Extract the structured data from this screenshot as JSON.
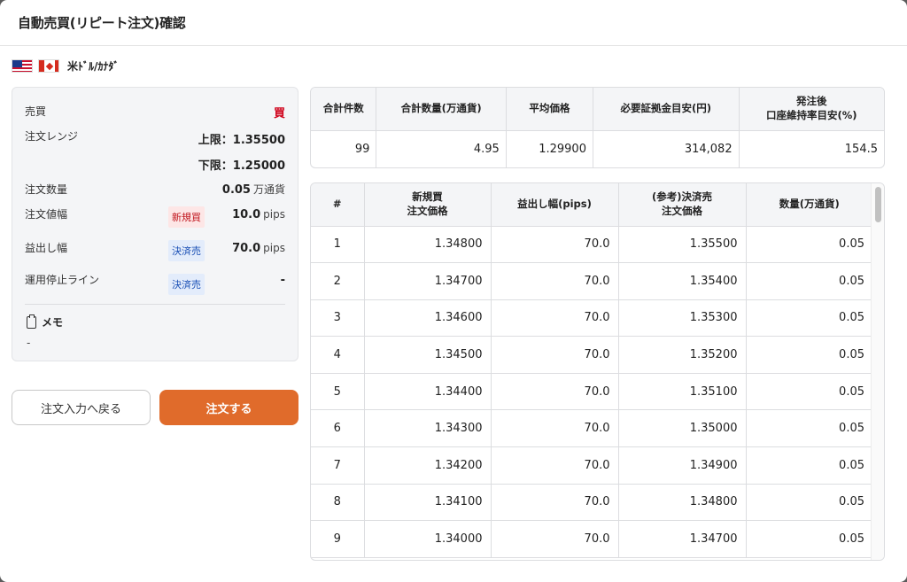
{
  "dialog": {
    "title": "自動売買(リピート注文)確認"
  },
  "pair": {
    "name": "米ﾄﾞﾙ/ｶﾅﾀﾞ",
    "flags": [
      "us-flag-icon",
      "canada-flag-icon"
    ]
  },
  "summary": {
    "side_label": "売買",
    "side_value": "買",
    "range_label": "注文レンジ",
    "upper": "上限：1.35500",
    "lower": "下限：1.25000",
    "qty_label": "注文数量",
    "qty_value": "0.05",
    "qty_unit": "万通貨",
    "width_label": "注文値幅",
    "width_badge": "新規買",
    "width_value": "10.0",
    "width_unit": "pips",
    "profit_label": "益出し幅",
    "profit_badge": "決済売",
    "profit_value": "70.0",
    "profit_unit": "pips",
    "stop_label": "運用停止ライン",
    "stop_badge": "決済売",
    "stop_value": "-",
    "memo_label": "メモ",
    "memo_value": "-"
  },
  "buttons": {
    "back": "注文入力へ戻る",
    "order": "注文する"
  },
  "totals": {
    "headers": [
      "合計件数",
      "合計数量(万通貨)",
      "平均価格",
      "必要証拠金目安(円)",
      "発注後\n口座維持率目安(%)"
    ],
    "values": [
      "99",
      "4.95",
      "1.29900",
      "314,082",
      "154.5"
    ]
  },
  "orders": {
    "headers": [
      "#",
      "新規買\n注文価格",
      "益出し幅(pips)",
      "(参考)決済売\n注文価格",
      "数量(万通貨)"
    ],
    "rows": [
      [
        "1",
        "1.34800",
        "70.0",
        "1.35500",
        "0.05"
      ],
      [
        "2",
        "1.34700",
        "70.0",
        "1.35400",
        "0.05"
      ],
      [
        "3",
        "1.34600",
        "70.0",
        "1.35300",
        "0.05"
      ],
      [
        "4",
        "1.34500",
        "70.0",
        "1.35200",
        "0.05"
      ],
      [
        "5",
        "1.34400",
        "70.0",
        "1.35100",
        "0.05"
      ],
      [
        "6",
        "1.34300",
        "70.0",
        "1.35000",
        "0.05"
      ],
      [
        "7",
        "1.34200",
        "70.0",
        "1.34900",
        "0.05"
      ],
      [
        "8",
        "1.34100",
        "70.0",
        "1.34800",
        "0.05"
      ],
      [
        "9",
        "1.34000",
        "70.0",
        "1.34700",
        "0.05"
      ]
    ]
  },
  "colors": {
    "accent": "#e06b2b",
    "buy": "#d0021b",
    "close_badge": "#1a4fb5",
    "new_badge": "#c0141c"
  }
}
